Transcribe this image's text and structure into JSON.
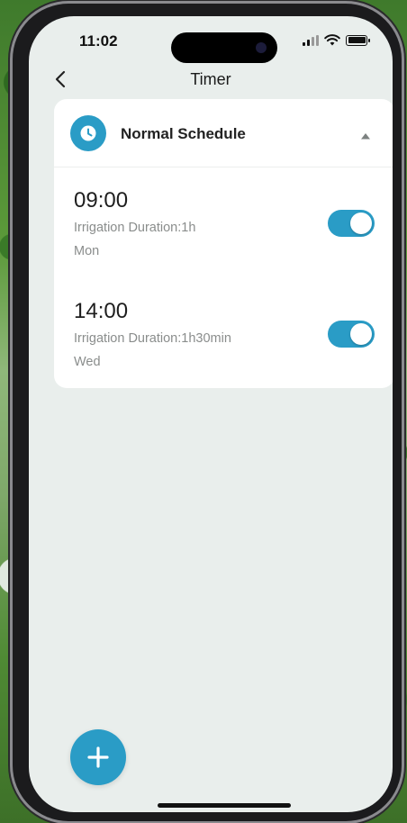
{
  "status_bar": {
    "time": "11:02",
    "battery_level": 1.0,
    "signal_bars": 2
  },
  "nav": {
    "title": "Timer",
    "back_icon": "chevron-left-icon"
  },
  "schedule_card": {
    "title": "Normal Schedule",
    "header_icon": "clock-icon",
    "collapse_icon": "caret-up-icon",
    "accent_color": "#2a9cc6",
    "entries": [
      {
        "time": "09:00",
        "duration": "Irrigation Duration:1h",
        "day": "Mon",
        "enabled": true
      },
      {
        "time": "14:00",
        "duration": "Irrigation Duration:1h30min",
        "day": "Wed",
        "enabled": true
      }
    ]
  },
  "fab": {
    "icon": "plus-icon"
  },
  "colors": {
    "accent": "#2a9cc6",
    "screen_bg": "#e9eeec",
    "card_bg": "#ffffff",
    "secondary_text": "#8a8d8c"
  }
}
